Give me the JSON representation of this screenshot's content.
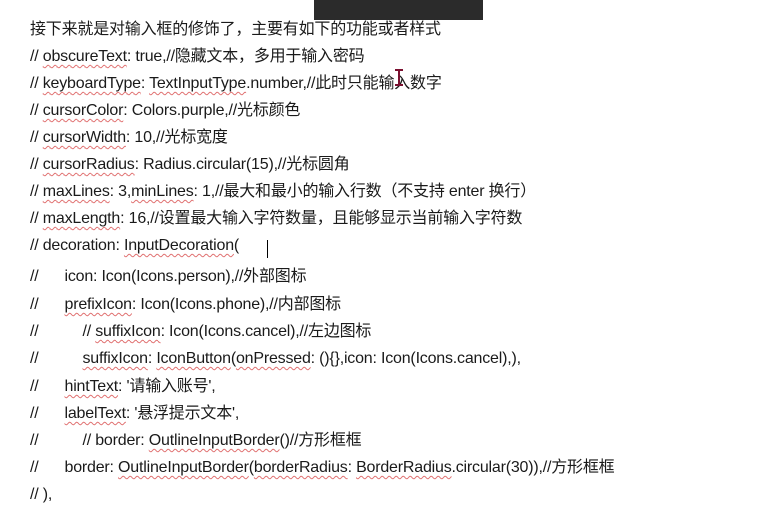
{
  "lines": [
    {
      "indent": 0,
      "segs": [
        {
          "t": "接下来就是对输入框的修饰了，主要有如下的功能或者样式"
        }
      ]
    },
    {
      "indent": 0,
      "segs": [
        {
          "t": "// "
        },
        {
          "t": "obscureText",
          "u": 1
        },
        {
          "t": ": true,//隐藏文本，多用于输入密码"
        }
      ]
    },
    {
      "indent": 0,
      "segs": [
        {
          "t": "// "
        },
        {
          "t": "keyboardType",
          "u": 1
        },
        {
          "t": ": "
        },
        {
          "t": "TextInputType",
          "u": 1
        },
        {
          "t": ".number,//此时只能输入数字"
        }
      ]
    },
    {
      "indent": 0,
      "segs": [
        {
          "t": "// "
        },
        {
          "t": "cursorColor",
          "u": 1
        },
        {
          "t": ": Colors.purple,//光标颜色"
        }
      ]
    },
    {
      "indent": 0,
      "segs": [
        {
          "t": "// "
        },
        {
          "t": "cursorWidth",
          "u": 1
        },
        {
          "t": ": 10,//光标宽度"
        }
      ]
    },
    {
      "indent": 0,
      "segs": [
        {
          "t": "// "
        },
        {
          "t": "cursorRadius",
          "u": 1
        },
        {
          "t": ": Radius.circular(15),//光标圆角"
        }
      ]
    },
    {
      "indent": 0,
      "segs": [
        {
          "t": "// "
        },
        {
          "t": "maxLines",
          "u": 1
        },
        {
          "t": ": 3,"
        },
        {
          "t": "minLines",
          "u": 1
        },
        {
          "t": ": 1,//最大和最小的输入行数（不支持 enter 换行）"
        }
      ]
    },
    {
      "indent": 0,
      "segs": [
        {
          "t": "// "
        },
        {
          "t": "maxLength",
          "u": 1
        },
        {
          "t": ": 16,//设置最大输入字符数量，且能够显示当前输入字符数"
        }
      ]
    },
    {
      "indent": 0,
      "segs": [
        {
          "t": "// decoration: "
        },
        {
          "t": "InputDecoration",
          "u": 1
        },
        {
          "t": "("
        }
      ]
    },
    {
      "indent": 1,
      "segs": [
        {
          "t": "icon: Icon(Icons.person),//外部图标"
        }
      ]
    },
    {
      "indent": 1,
      "segs": [
        {
          "t": "prefixIcon",
          "u": 1
        },
        {
          "t": ": Icon(Icons.phone),//内部图标"
        }
      ]
    },
    {
      "indent": 2,
      "segs": [
        {
          "t": "// "
        },
        {
          "t": "suffixIcon",
          "u": 1
        },
        {
          "t": ": Icon(Icons.cancel),//左边图标"
        }
      ]
    },
    {
      "indent": 2,
      "segs": [
        {
          "t": "suffixIcon",
          "u": 1
        },
        {
          "t": ": "
        },
        {
          "t": "IconButton",
          "u": 1
        },
        {
          "t": "("
        },
        {
          "t": "onPressed",
          "u": 1
        },
        {
          "t": ": (){},icon: Icon(Icons.cancel),),"
        }
      ]
    },
    {
      "indent": 1,
      "segs": [
        {
          "t": "hintText",
          "u": 1
        },
        {
          "t": ": '请输入账号',"
        }
      ]
    },
    {
      "indent": 1,
      "segs": [
        {
          "t": "labelText",
          "u": 1
        },
        {
          "t": ": '悬浮提示文本',"
        }
      ]
    },
    {
      "indent": 2,
      "segs": [
        {
          "t": "// border: "
        },
        {
          "t": "OutlineInputBorder",
          "u": 1
        },
        {
          "t": "()//方形框框"
        }
      ]
    },
    {
      "indent": 1,
      "segs": [
        {
          "t": "border: "
        },
        {
          "t": "OutlineInputBorder",
          "u": 1
        },
        {
          "t": "("
        },
        {
          "t": "borderRadius",
          "u": 1
        },
        {
          "t": ": "
        },
        {
          "t": "BorderRadius",
          "u": 1
        },
        {
          "t": ".circular(30)),//方形框框"
        }
      ]
    },
    {
      "indent": 0,
      "segs": [
        {
          "t": "// ),"
        }
      ]
    }
  ],
  "comment_prefix": "//",
  "colors": {
    "spell_underline": "#e07070",
    "cursor": "#7a1030"
  }
}
